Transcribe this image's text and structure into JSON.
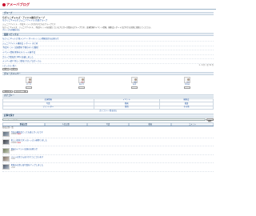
{
  "site": {
    "logo_text": "アメーバブログ"
  },
  "group": {
    "section_label": "グループ",
    "title": "ちびっこギャルズ・アイドル総合グループ",
    "subtitle": "ちびっこギャルズ ジュニアアイドル 応援グループ",
    "tagline": "ジュニアアイドル・子役タレントが大好きな方のグループです",
    "description": "ちびっこギャルズ、ジュニアアイドル、子役タレントを応援しているブロガーが集まるグループです。出演情報やイベント情報、撮影会レポートなど何でも気軽に投稿してください。",
    "more_link": "グループの詳細を見る"
  },
  "news": {
    "section_label": "最新トピックス",
    "items": [
      "ちびっこギャルズ 新メンバー オーディション開催決定のお知らせ",
      "ジュニアアイドル撮影会 レポート まとめ",
      "子役タレント 出演情報 今週のテレビ番組",
      "イベント情報 夏休みスペシャル握手会",
      "グループ参加者 100人突破しました",
      "メンバー紹介 新しく参加されたブロガーさん"
    ],
    "more": "トピックス一覧へ"
  },
  "pager": {
    "prev": "前へ",
    "next": "次へ",
    "count": "1 - 6 件 / 全 52 件"
  },
  "members": {
    "section_label": "グループメンバー",
    "users": [
      {
        "name": "さくら",
        "avatar": "avatar-icon"
      },
      {
        "name": "あいり",
        "avatar": "avatar-icon"
      },
      {
        "name": "みゆ",
        "avatar": "avatar-icon"
      },
      {
        "name": "ななみ",
        "avatar": "avatar-icon"
      }
    ],
    "join_button": "参加する",
    "list_button": "メンバー一覧"
  },
  "categories": {
    "section_label": "カテゴリー",
    "rows": [
      [
        "出演情報",
        "イベント",
        "撮影会"
      ],
      [
        "写真",
        "動画",
        "雑談"
      ],
      [
        "ファンレター",
        "質問",
        "その他"
      ]
    ],
    "more": "カテゴリー一覧を見る"
  },
  "search": {
    "section_label": "記事を探す",
    "placeholder": "キーワードを入力",
    "button": "検索"
  },
  "tabs": [
    "新着記事",
    "人気記事",
    "写真",
    "動画",
    "コメント"
  ],
  "posts": {
    "label": "新着記事一覧",
    "items": [
      {
        "title": "今日の撮影会とっても楽しかったです",
        "meta": "2時間前",
        "badge": "NEW"
      },
      {
        "title": "新しい衣装でダンスレッスン頑張りました",
        "meta": "5時間前",
        "badge": "NEW"
      },
      {
        "title": "週末のイベント出演のお知らせ",
        "meta": "昨日",
        "badge": ""
      },
      {
        "title": "ファンの皆さんありがとうございます",
        "meta": "2日前",
        "badge": ""
      },
      {
        "title": "夏休みの思い出写真をアップしました",
        "meta": "3日前",
        "badge": ""
      }
    ]
  }
}
